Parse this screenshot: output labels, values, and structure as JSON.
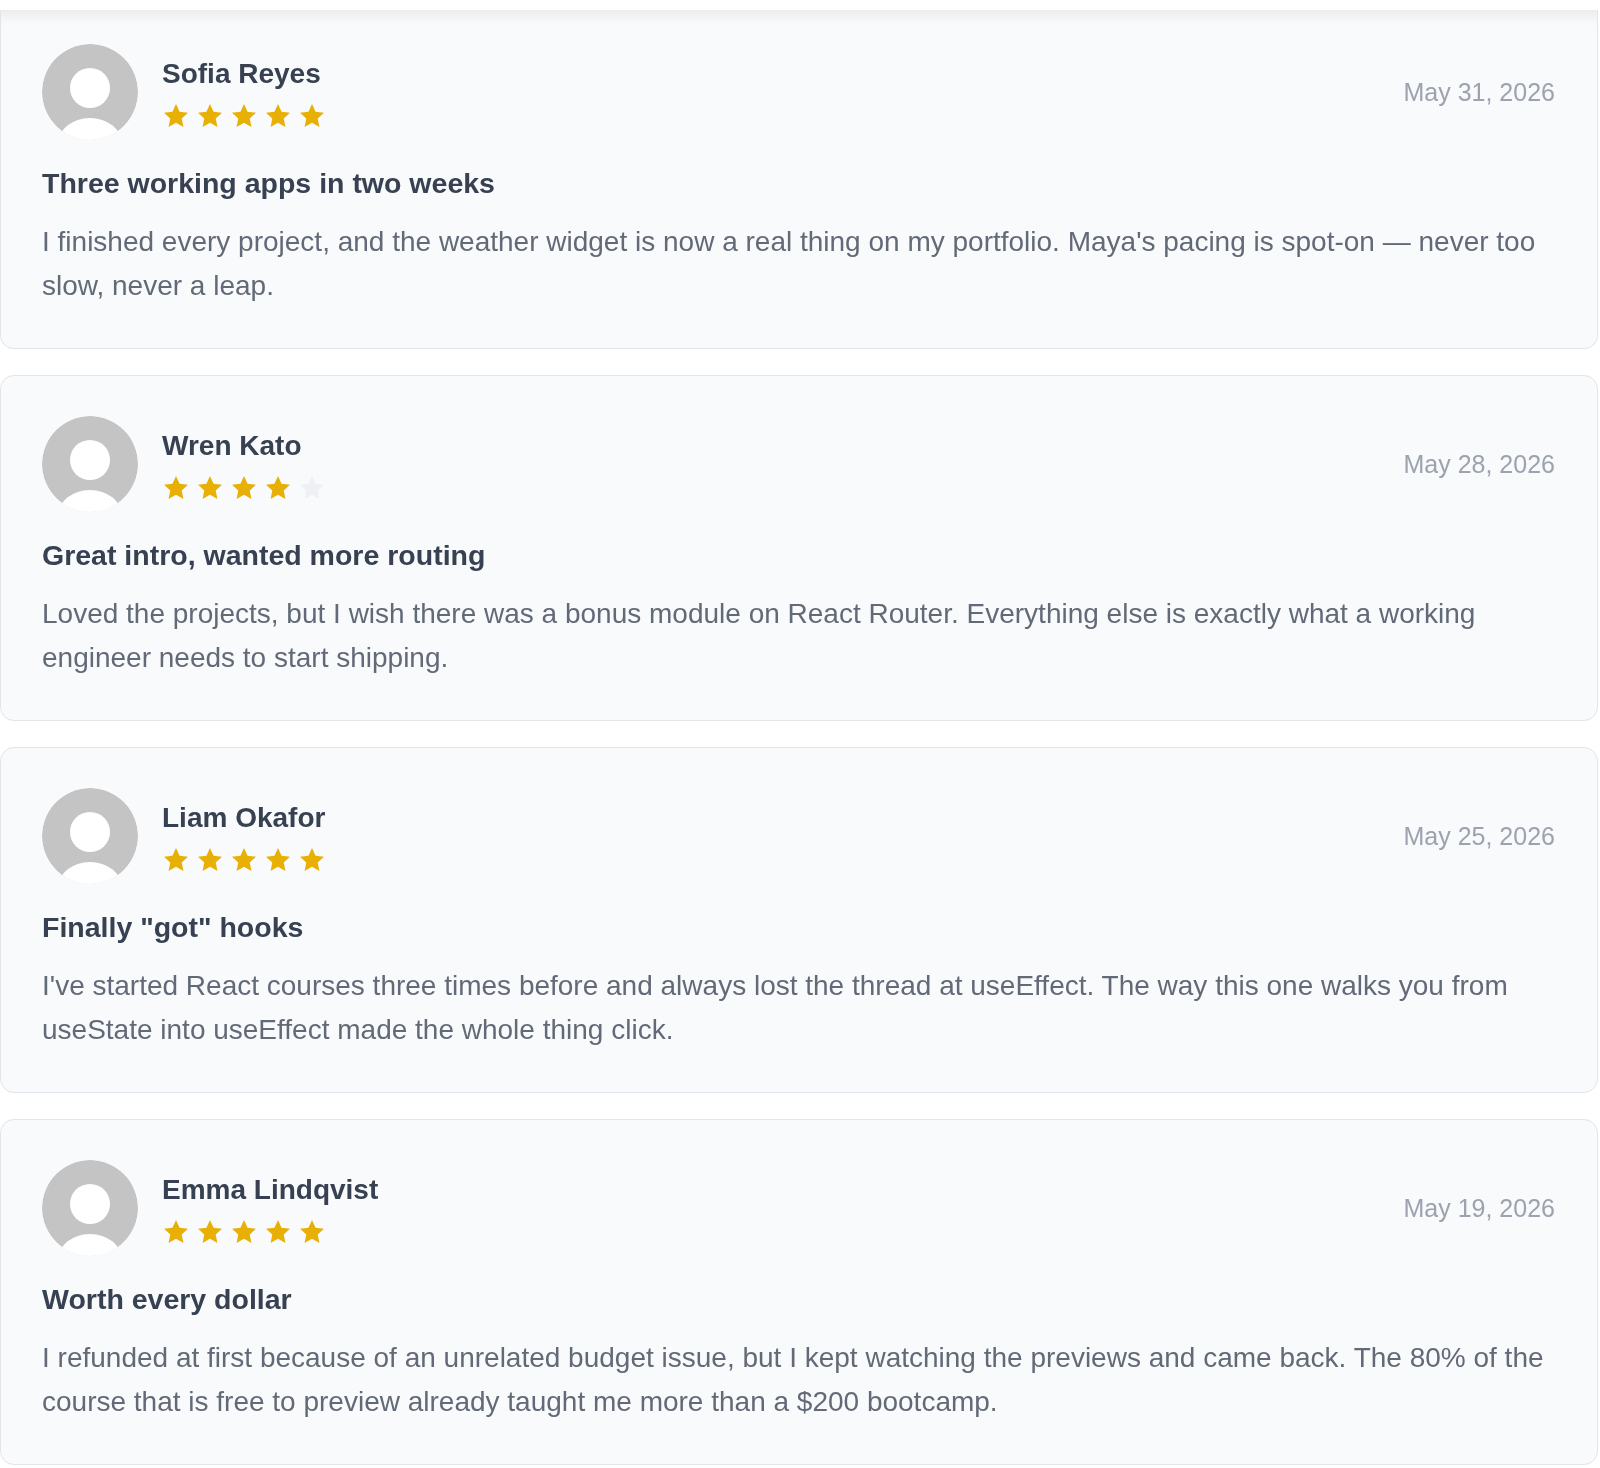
{
  "reviews": [
    {
      "name": "Sofia Reyes",
      "stars": 5,
      "date": "May 31, 2026",
      "title": "Three working apps in two weeks",
      "body": "I finished every project, and the weather widget is now a real thing on my portfolio. Maya's pacing is spot-on — never too slow, never a leap."
    },
    {
      "name": "Wren Kato",
      "stars": 4,
      "date": "May 28, 2026",
      "title": "Great intro, wanted more routing",
      "body": "Loved the projects, but I wish there was a bonus module on React Router. Everything else is exactly what a working engineer needs to start shipping."
    },
    {
      "name": "Liam Okafor",
      "stars": 5,
      "date": "May 25, 2026",
      "title": "Finally \"got\" hooks",
      "body": "I've started React courses three times before and always lost the thread at useEffect. The way this one walks you from useState into useEffect made the whole thing click."
    },
    {
      "name": "Emma Lindqvist",
      "stars": 5,
      "date": "May 19, 2026",
      "title": "Worth every dollar",
      "body": "I refunded at first because of an unrelated budget issue, but I kept watching the previews and came back. The 80% of the course that is free to preview already taught me more than a $200 bootcamp."
    }
  ]
}
